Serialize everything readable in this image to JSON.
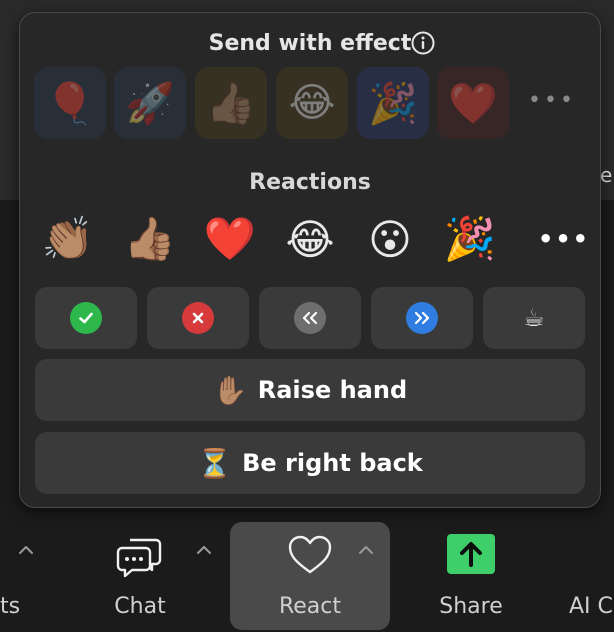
{
  "popup": {
    "effects_title": "Send with effect",
    "effects": [
      {
        "icon": "🎈",
        "name": "balloon"
      },
      {
        "icon": "🚀",
        "name": "rocket"
      },
      {
        "icon": "👍🏽",
        "name": "thumbs-up"
      },
      {
        "icon": "😂",
        "name": "laughing"
      },
      {
        "icon": "🎉",
        "name": "party-popper"
      },
      {
        "icon": "❤️",
        "name": "heart"
      }
    ],
    "effects_more": "•••",
    "reactions_title": "Reactions",
    "reactions": [
      {
        "icon": "👏🏽",
        "name": "clap"
      },
      {
        "icon": "👍🏽",
        "name": "thumbs-up"
      },
      {
        "icon": "❤️",
        "name": "heart"
      },
      {
        "icon": "😂",
        "name": "laughing"
      },
      {
        "icon": "😮",
        "name": "surprised"
      },
      {
        "icon": "🎉",
        "name": "party"
      }
    ],
    "reactions_more": "•••",
    "status_buttons": [
      {
        "glyph": "✓",
        "color": "#2eb84b",
        "name": "yes"
      },
      {
        "glyph": "✕",
        "color": "#d63a3a",
        "name": "no"
      },
      {
        "glyph": "«",
        "color": "#6e6e6e",
        "name": "slower"
      },
      {
        "glyph": "»",
        "color": "#2f7de1",
        "name": "faster"
      },
      {
        "glyph": "☕",
        "color": "transparent",
        "name": "coffee"
      }
    ],
    "raise_hand": {
      "icon": "✋🏽",
      "label": "Raise hand"
    },
    "be_right_back": {
      "icon": "⏳",
      "label": "Be right back"
    }
  },
  "background_text": "e",
  "toolbar": {
    "items": [
      {
        "label": "ts"
      },
      {
        "label": "Chat"
      },
      {
        "label": "React"
      },
      {
        "label": "Share"
      },
      {
        "label": "AI C"
      }
    ]
  }
}
